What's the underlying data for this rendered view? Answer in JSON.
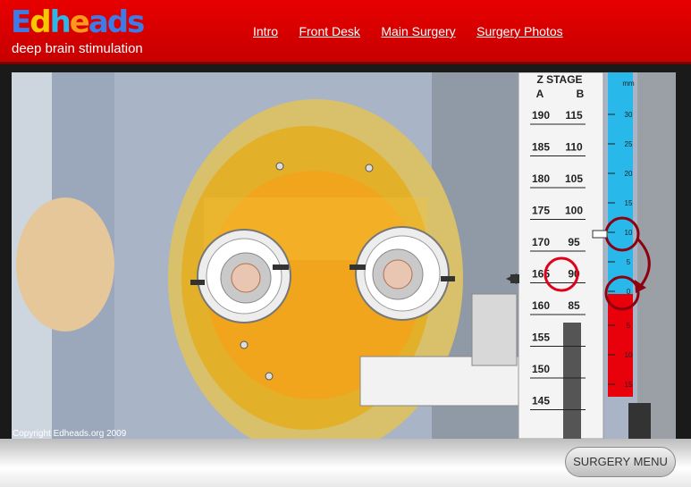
{
  "header": {
    "logo": {
      "e": "E",
      "d": "d",
      "h": "h",
      "a": "e",
      "rest": "ads"
    },
    "tagline": "deep brain stimulation",
    "nav": [
      "Intro",
      "Front Desk",
      "Main Surgery",
      "Surgery Photos"
    ]
  },
  "zstage": {
    "title": "Z STAGE",
    "col_a": "A",
    "col_b": "B",
    "a_ticks": [
      "190",
      "185",
      "180",
      "175",
      "170",
      "165",
      "160",
      "155",
      "150",
      "145"
    ],
    "b_ticks": [
      "115",
      "110",
      "105",
      "100",
      "95",
      "90",
      "85"
    ],
    "highlighted_b": "90"
  },
  "mm_scale": {
    "unit": "mm",
    "positive_labels": [
      "30",
      "25",
      "20",
      "15",
      "10",
      "5",
      "0"
    ],
    "negative_labels": [
      "5",
      "10",
      "15"
    ],
    "circled": [
      "10",
      "0"
    ]
  },
  "copyright": "Copyright Edheads.org 2009",
  "menu_button": "SURGERY MENU",
  "colors": {
    "header_red": "#d40000",
    "scale_blue": "#28b8ea",
    "scale_red": "#e8000a",
    "circle_red": "#e0001a",
    "arrow_dark_red": "#8c0010"
  }
}
